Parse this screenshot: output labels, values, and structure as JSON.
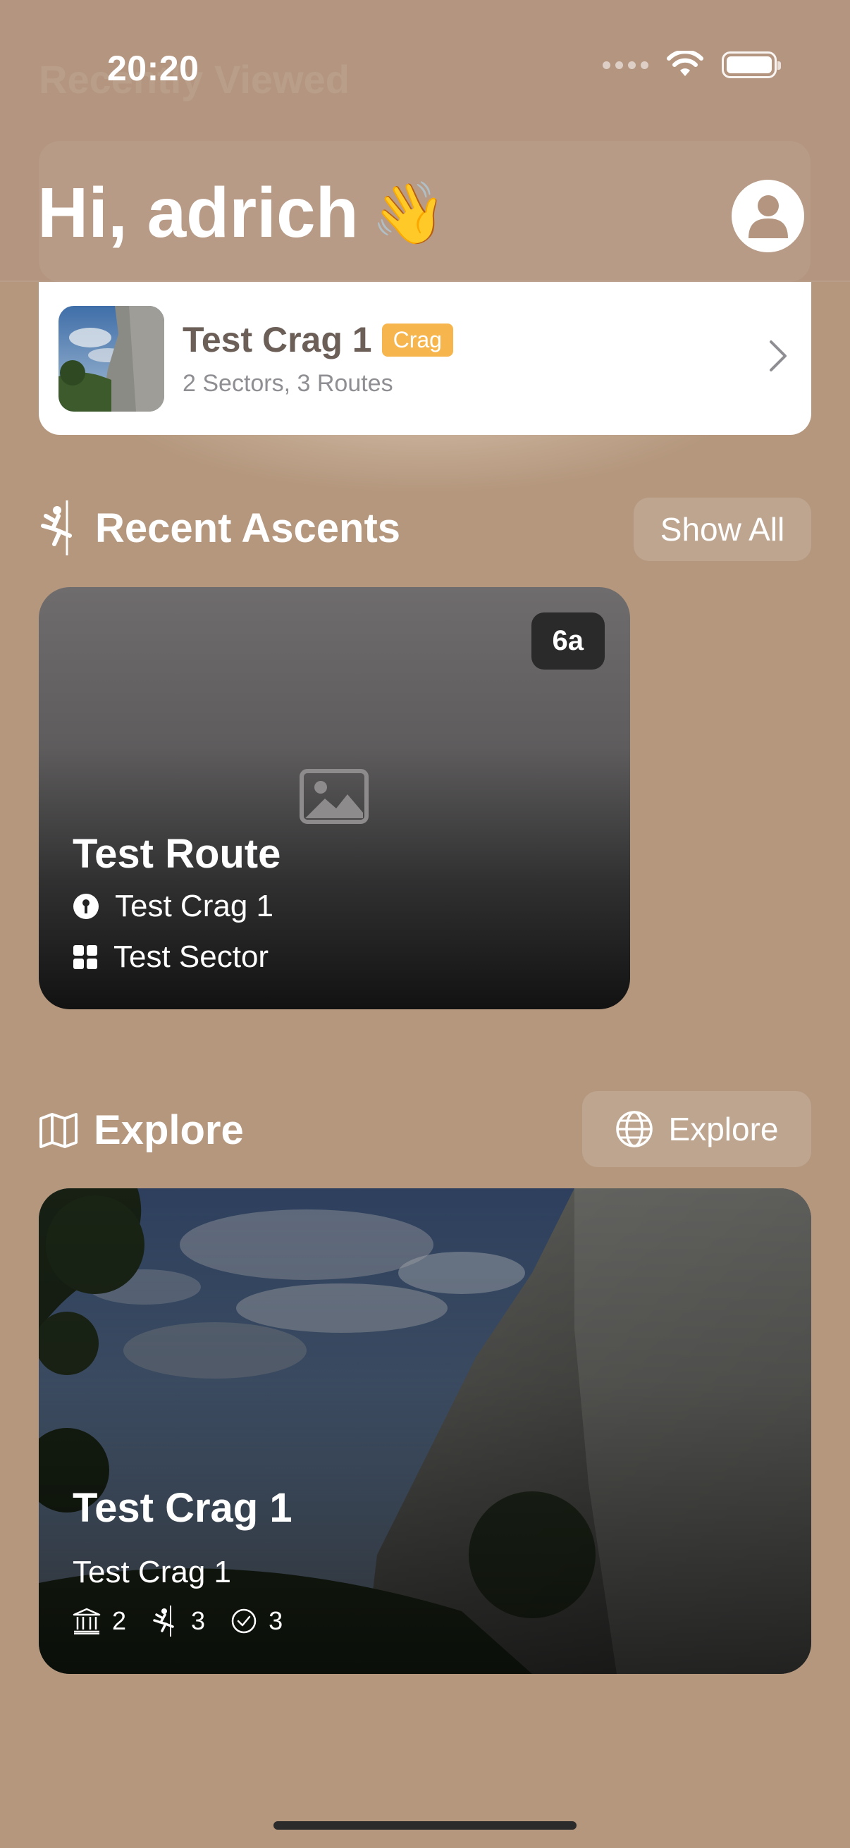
{
  "status_bar": {
    "time": "20:20"
  },
  "header": {
    "ghost_title": "Recently Viewed",
    "greeting": "Hi, adrich",
    "greeting_emoji": "👋"
  },
  "recently_viewed": {
    "title": "Test Crag 1",
    "tag": "Crag",
    "subtitle": "2 Sectors, 3 Routes"
  },
  "recent_ascents": {
    "title": "Recent Ascents",
    "show_all": "Show All",
    "card": {
      "grade": "6a",
      "route": "Test Route",
      "crag": "Test Crag 1",
      "sector": "Test Sector"
    }
  },
  "explore": {
    "title": "Explore",
    "button": "Explore",
    "card": {
      "title": "Test Crag 1",
      "subtitle": "Test Crag 1",
      "stats": {
        "sectors": "2",
        "routes": "3",
        "ascents": "3"
      }
    }
  },
  "colors": {
    "background": "#b4977d",
    "tag": "#f6b64d",
    "card": "#ffffff"
  }
}
